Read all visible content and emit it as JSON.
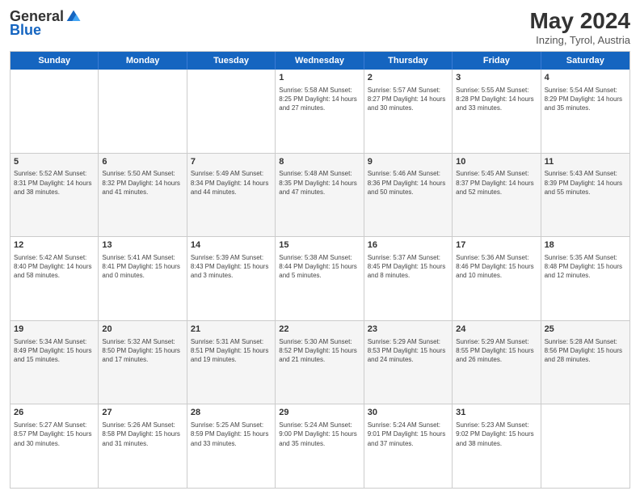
{
  "header": {
    "logo_general": "General",
    "logo_blue": "Blue",
    "month_year": "May 2024",
    "location": "Inzing, Tyrol, Austria"
  },
  "days": [
    "Sunday",
    "Monday",
    "Tuesday",
    "Wednesday",
    "Thursday",
    "Friday",
    "Saturday"
  ],
  "weeks": [
    [
      {
        "date": "",
        "info": ""
      },
      {
        "date": "",
        "info": ""
      },
      {
        "date": "",
        "info": ""
      },
      {
        "date": "1",
        "info": "Sunrise: 5:58 AM\nSunset: 8:25 PM\nDaylight: 14 hours\nand 27 minutes."
      },
      {
        "date": "2",
        "info": "Sunrise: 5:57 AM\nSunset: 8:27 PM\nDaylight: 14 hours\nand 30 minutes."
      },
      {
        "date": "3",
        "info": "Sunrise: 5:55 AM\nSunset: 8:28 PM\nDaylight: 14 hours\nand 33 minutes."
      },
      {
        "date": "4",
        "info": "Sunrise: 5:54 AM\nSunset: 8:29 PM\nDaylight: 14 hours\nand 35 minutes."
      }
    ],
    [
      {
        "date": "5",
        "info": "Sunrise: 5:52 AM\nSunset: 8:31 PM\nDaylight: 14 hours\nand 38 minutes."
      },
      {
        "date": "6",
        "info": "Sunrise: 5:50 AM\nSunset: 8:32 PM\nDaylight: 14 hours\nand 41 minutes."
      },
      {
        "date": "7",
        "info": "Sunrise: 5:49 AM\nSunset: 8:34 PM\nDaylight: 14 hours\nand 44 minutes."
      },
      {
        "date": "8",
        "info": "Sunrise: 5:48 AM\nSunset: 8:35 PM\nDaylight: 14 hours\nand 47 minutes."
      },
      {
        "date": "9",
        "info": "Sunrise: 5:46 AM\nSunset: 8:36 PM\nDaylight: 14 hours\nand 50 minutes."
      },
      {
        "date": "10",
        "info": "Sunrise: 5:45 AM\nSunset: 8:37 PM\nDaylight: 14 hours\nand 52 minutes."
      },
      {
        "date": "11",
        "info": "Sunrise: 5:43 AM\nSunset: 8:39 PM\nDaylight: 14 hours\nand 55 minutes."
      }
    ],
    [
      {
        "date": "12",
        "info": "Sunrise: 5:42 AM\nSunset: 8:40 PM\nDaylight: 14 hours\nand 58 minutes."
      },
      {
        "date": "13",
        "info": "Sunrise: 5:41 AM\nSunset: 8:41 PM\nDaylight: 15 hours\nand 0 minutes."
      },
      {
        "date": "14",
        "info": "Sunrise: 5:39 AM\nSunset: 8:43 PM\nDaylight: 15 hours\nand 3 minutes."
      },
      {
        "date": "15",
        "info": "Sunrise: 5:38 AM\nSunset: 8:44 PM\nDaylight: 15 hours\nand 5 minutes."
      },
      {
        "date": "16",
        "info": "Sunrise: 5:37 AM\nSunset: 8:45 PM\nDaylight: 15 hours\nand 8 minutes."
      },
      {
        "date": "17",
        "info": "Sunrise: 5:36 AM\nSunset: 8:46 PM\nDaylight: 15 hours\nand 10 minutes."
      },
      {
        "date": "18",
        "info": "Sunrise: 5:35 AM\nSunset: 8:48 PM\nDaylight: 15 hours\nand 12 minutes."
      }
    ],
    [
      {
        "date": "19",
        "info": "Sunrise: 5:34 AM\nSunset: 8:49 PM\nDaylight: 15 hours\nand 15 minutes."
      },
      {
        "date": "20",
        "info": "Sunrise: 5:32 AM\nSunset: 8:50 PM\nDaylight: 15 hours\nand 17 minutes."
      },
      {
        "date": "21",
        "info": "Sunrise: 5:31 AM\nSunset: 8:51 PM\nDaylight: 15 hours\nand 19 minutes."
      },
      {
        "date": "22",
        "info": "Sunrise: 5:30 AM\nSunset: 8:52 PM\nDaylight: 15 hours\nand 21 minutes."
      },
      {
        "date": "23",
        "info": "Sunrise: 5:29 AM\nSunset: 8:53 PM\nDaylight: 15 hours\nand 24 minutes."
      },
      {
        "date": "24",
        "info": "Sunrise: 5:29 AM\nSunset: 8:55 PM\nDaylight: 15 hours\nand 26 minutes."
      },
      {
        "date": "25",
        "info": "Sunrise: 5:28 AM\nSunset: 8:56 PM\nDaylight: 15 hours\nand 28 minutes."
      }
    ],
    [
      {
        "date": "26",
        "info": "Sunrise: 5:27 AM\nSunset: 8:57 PM\nDaylight: 15 hours\nand 30 minutes."
      },
      {
        "date": "27",
        "info": "Sunrise: 5:26 AM\nSunset: 8:58 PM\nDaylight: 15 hours\nand 31 minutes."
      },
      {
        "date": "28",
        "info": "Sunrise: 5:25 AM\nSunset: 8:59 PM\nDaylight: 15 hours\nand 33 minutes."
      },
      {
        "date": "29",
        "info": "Sunrise: 5:24 AM\nSunset: 9:00 PM\nDaylight: 15 hours\nand 35 minutes."
      },
      {
        "date": "30",
        "info": "Sunrise: 5:24 AM\nSunset: 9:01 PM\nDaylight: 15 hours\nand 37 minutes."
      },
      {
        "date": "31",
        "info": "Sunrise: 5:23 AM\nSunset: 9:02 PM\nDaylight: 15 hours\nand 38 minutes."
      },
      {
        "date": "",
        "info": ""
      }
    ]
  ]
}
